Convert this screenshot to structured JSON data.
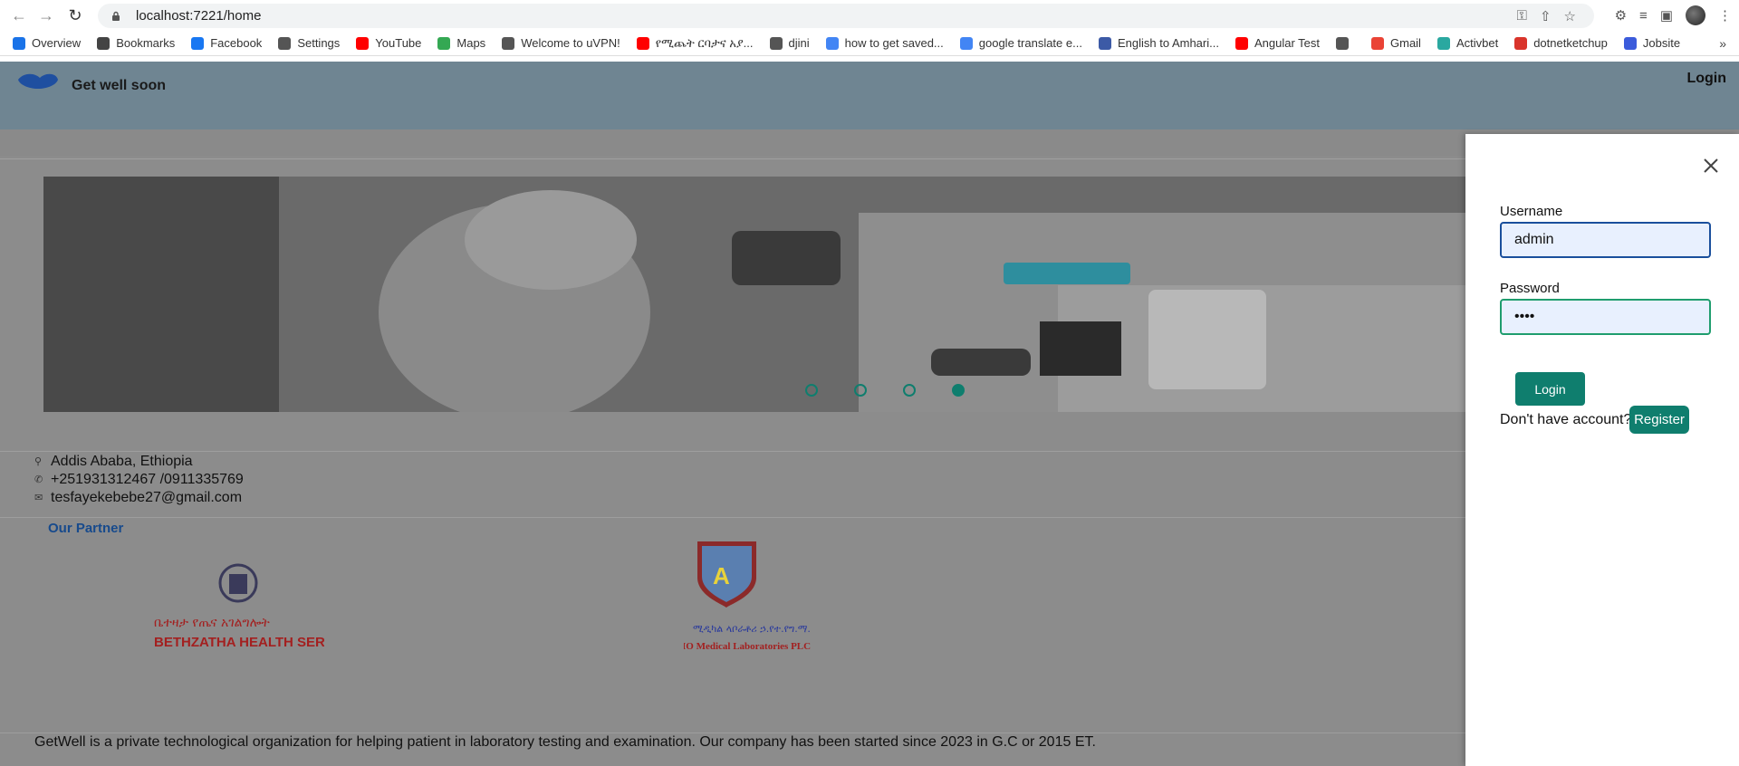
{
  "browser": {
    "url": "localhost:7221/home",
    "bookmarks": [
      {
        "label": "Overview",
        "icon": "overview-icon",
        "color": "#1a73e8"
      },
      {
        "label": "Bookmarks",
        "icon": "star-icon",
        "color": "#444444"
      },
      {
        "label": "Facebook",
        "icon": "facebook-icon",
        "color": "#1877f2"
      },
      {
        "label": "Settings",
        "icon": "gear-icon",
        "color": "#555555"
      },
      {
        "label": "YouTube",
        "icon": "youtube-icon",
        "color": "#ff0000"
      },
      {
        "label": "Maps",
        "icon": "maps-icon",
        "color": "#34a853"
      },
      {
        "label": "Welcome to uVPN!",
        "icon": "globe-icon",
        "color": "#555555"
      },
      {
        "label": "የሚጨት ርባታና አያ...",
        "icon": "youtube-icon",
        "color": "#ff0000"
      },
      {
        "label": "djini",
        "icon": "globe-icon",
        "color": "#555555"
      },
      {
        "label": "how to get saved...",
        "icon": "google-icon",
        "color": "#4285f4"
      },
      {
        "label": "google translate e...",
        "icon": "google-icon",
        "color": "#4285f4"
      },
      {
        "label": "English to Amhari...",
        "icon": "dictionary-icon",
        "color": "#3c5aa6"
      },
      {
        "label": "Angular Test",
        "icon": "youtube-icon",
        "color": "#ff0000"
      },
      {
        "label": "",
        "icon": "globe-icon",
        "color": "#555555"
      },
      {
        "label": "Gmail",
        "icon": "gmail-icon",
        "color": "#ea4335"
      },
      {
        "label": "Activbet",
        "icon": "activbet-icon",
        "color": "#2aa8a0"
      },
      {
        "label": "dotnetketchup",
        "icon": "dotnet-icon",
        "color": "#d9342b"
      },
      {
        "label": "Jobsite",
        "icon": "jobsite-icon",
        "color": "#3b5bdb"
      }
    ]
  },
  "header": {
    "brand": "Get well soon",
    "login_link": "Login"
  },
  "carousel": {
    "slides": 4,
    "active_index": 3
  },
  "contact": {
    "address": "Addis Ababa, Ethiopia",
    "phone": "+251931312467 /0911335769",
    "email": "tesfayekebebe27@gmail.com"
  },
  "partners": {
    "title": "Our Partner",
    "partner1": {
      "line1": "ቤተዛታ የጤና አገልግሎት",
      "line2": "BETHZATHA HEALTH SERVICE"
    },
    "partner2": {
      "line1": "ሚዲካል ላቦራቶሪ ኃ.የተ.የግ.ማ.",
      "line2": "IO Medical Laboratories PLC"
    }
  },
  "footer": {
    "about": "GetWell is a private technological organization for helping patient in laboratory testing and examination. Our company has been started since 2023 in G.C or 2015 ET."
  },
  "login_drawer": {
    "username_label": "Username",
    "username_value": "admin",
    "password_label": "Password",
    "password_value": "••••",
    "login_button": "Login",
    "no_account_text": "Don't have account?",
    "register_button": "Register"
  },
  "colors": {
    "primary": "#0f7e6e",
    "header_bg": "#6f8592",
    "partner_title": "#174a8c"
  }
}
